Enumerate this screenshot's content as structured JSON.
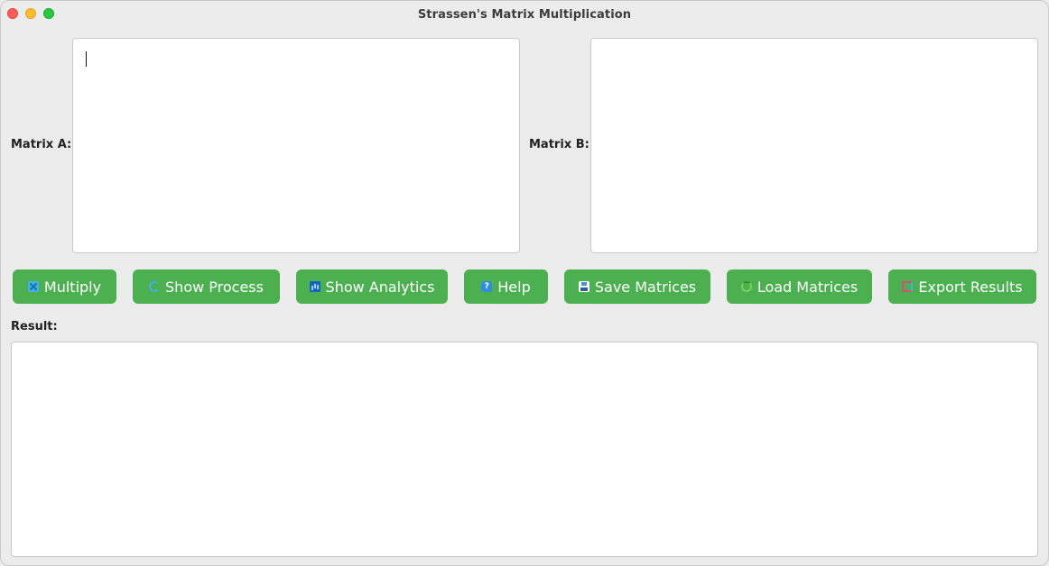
{
  "window": {
    "title": "Strassen's Matrix Multiplication"
  },
  "labels": {
    "matrix_a": "Matrix A:",
    "matrix_b": "Matrix B:",
    "result": "Result:"
  },
  "inputs": {
    "matrix_a_value": "",
    "matrix_b_value": "",
    "result_value": ""
  },
  "buttons": {
    "multiply": "Multiply",
    "show_process": "Show Process",
    "show_analytics": "Show Analytics",
    "help": "Help",
    "save_matrices": "Save Matrices",
    "load_matrices": "Load Matrices",
    "export_results": "Export Results"
  },
  "icons": {
    "multiply": "multiply-icon",
    "show_process": "cycle-icon",
    "show_analytics": "chart-icon",
    "help": "help-icon",
    "save_matrices": "save-icon",
    "load_matrices": "load-icon",
    "export_results": "export-icon"
  },
  "colors": {
    "button_bg": "#4caf50",
    "button_text": "#ffffff",
    "window_bg": "#ececec"
  }
}
